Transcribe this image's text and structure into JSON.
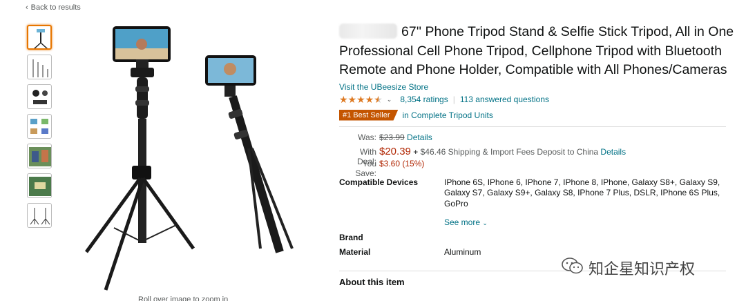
{
  "nav": {
    "back_label": "Back to results"
  },
  "product": {
    "title": "67'' Phone Tripod Stand & Selfie Stick Tripod, All in One Professional Cell Phone Tripod, Cellphone Tripod with Bluetooth Remote and Phone Holder, Compatible with All Phones/Cameras",
    "store_link": "Visit the UBeesize Store",
    "rating_value": 4.5,
    "stars_icon": "star-rating-icon",
    "ratings_count": "8,354 ratings",
    "answered_questions": "113 answered questions",
    "best_seller_badge": "#1 Best Seller",
    "best_seller_category": "in Complete Tripod Units",
    "caption": "Roll over image to zoom in"
  },
  "price": {
    "was_label": "Was:",
    "was_value": "$23.99",
    "details_link": "Details",
    "deal_label": "With Deal:",
    "deal_value": "$20.39",
    "plus": "+",
    "shipping_text": "$46.46 Shipping & Import Fees Deposit to China",
    "shipping_details_link": "Details",
    "save_label": "You Save:",
    "save_value": "$3.60 (15%)"
  },
  "specs": {
    "devices_label": "Compatible Devices",
    "devices_value": "IPhone 6S, IPhone 6, IPhone 7, IPhone 8, IPhone, Galaxy S8+, Galaxy S9, Galaxy S7, Galaxy S9+, Galaxy S8, IPhone 7 Plus, DSLR, IPhone 6S Plus, GoPro",
    "see_more": "See more",
    "brand_label": "Brand",
    "brand_value": "",
    "material_label": "Material",
    "material_value": "Aluminum"
  },
  "about": {
    "heading": "About this item"
  },
  "watermark": {
    "text": "知企星知识产权",
    "icon": "wechat-icon"
  },
  "colors": {
    "link": "#007185",
    "price": "#b12704",
    "badge": "#c45500",
    "star": "#de7921",
    "thumb_active": "#e77600"
  }
}
